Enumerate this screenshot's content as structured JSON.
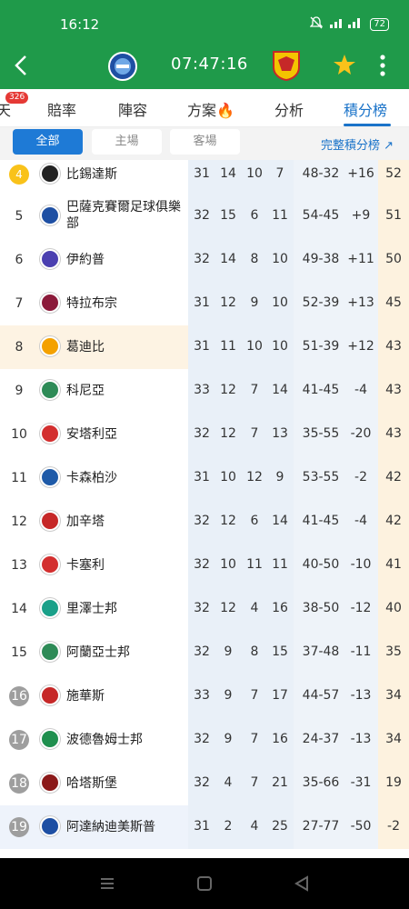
{
  "status": {
    "time": "16:12",
    "battery": "72"
  },
  "header": {
    "clock": "07:47:16"
  },
  "tabs": [
    {
      "label": "天"
    },
    {
      "label": "賠率"
    },
    {
      "label": "陣容"
    },
    {
      "label": "方案"
    },
    {
      "label": "分析"
    },
    {
      "label": "積分榜"
    }
  ],
  "tab_badge": "326",
  "filter": {
    "all": "全部",
    "home": "主場",
    "away": "客場",
    "full_link": "完整積分榜 ↗"
  },
  "colors": {
    "brand_green": "#1f9a4a",
    "accent_blue": "#1a73c9",
    "highlight_row": "#fdf3e3"
  },
  "rows": [
    {
      "rank": "4",
      "team": "比錫達斯",
      "p": "31",
      "w": "14",
      "d": "10",
      "l": "7",
      "gf": "48-32",
      "gd": "+16",
      "pts": "52"
    },
    {
      "rank": "5",
      "team": "巴薩克賽爾足球俱樂部",
      "p": "32",
      "w": "15",
      "d": "6",
      "l": "11",
      "gf": "54-45",
      "gd": "+9",
      "pts": "51"
    },
    {
      "rank": "6",
      "team": "伊約普",
      "p": "32",
      "w": "14",
      "d": "8",
      "l": "10",
      "gf": "49-38",
      "gd": "+11",
      "pts": "50"
    },
    {
      "rank": "7",
      "team": "特拉布宗",
      "p": "31",
      "w": "12",
      "d": "9",
      "l": "10",
      "gf": "52-39",
      "gd": "+13",
      "pts": "45"
    },
    {
      "rank": "8",
      "team": "葛迪比",
      "p": "31",
      "w": "11",
      "d": "10",
      "l": "10",
      "gf": "51-39",
      "gd": "+12",
      "pts": "43"
    },
    {
      "rank": "9",
      "team": "科尼亞",
      "p": "33",
      "w": "12",
      "d": "7",
      "l": "14",
      "gf": "41-45",
      "gd": "-4",
      "pts": "43"
    },
    {
      "rank": "10",
      "team": "安塔利亞",
      "p": "32",
      "w": "12",
      "d": "7",
      "l": "13",
      "gf": "35-55",
      "gd": "-20",
      "pts": "43"
    },
    {
      "rank": "11",
      "team": "卡森柏沙",
      "p": "31",
      "w": "10",
      "d": "12",
      "l": "9",
      "gf": "53-55",
      "gd": "-2",
      "pts": "42"
    },
    {
      "rank": "12",
      "team": "加辛塔",
      "p": "32",
      "w": "12",
      "d": "6",
      "l": "14",
      "gf": "41-45",
      "gd": "-4",
      "pts": "42"
    },
    {
      "rank": "13",
      "team": "卡塞利",
      "p": "32",
      "w": "10",
      "d": "11",
      "l": "11",
      "gf": "40-50",
      "gd": "-10",
      "pts": "41"
    },
    {
      "rank": "14",
      "team": "里澤士邦",
      "p": "32",
      "w": "12",
      "d": "4",
      "l": "16",
      "gf": "38-50",
      "gd": "-12",
      "pts": "40"
    },
    {
      "rank": "15",
      "team": "阿蘭亞士邦",
      "p": "32",
      "w": "9",
      "d": "8",
      "l": "15",
      "gf": "37-48",
      "gd": "-11",
      "pts": "35"
    },
    {
      "rank": "16",
      "team": "施華斯",
      "p": "33",
      "w": "9",
      "d": "7",
      "l": "17",
      "gf": "44-57",
      "gd": "-13",
      "pts": "34"
    },
    {
      "rank": "17",
      "team": "波德魯姆士邦",
      "p": "32",
      "w": "9",
      "d": "7",
      "l": "16",
      "gf": "24-37",
      "gd": "-13",
      "pts": "34"
    },
    {
      "rank": "18",
      "team": "哈塔斯堡",
      "p": "32",
      "w": "4",
      "d": "7",
      "l": "21",
      "gf": "35-66",
      "gd": "-31",
      "pts": "19"
    },
    {
      "rank": "19",
      "team": "阿達納迪美斯普",
      "p": "31",
      "w": "2",
      "d": "4",
      "l": "25",
      "gf": "27-77",
      "gd": "-50",
      "pts": "-2"
    }
  ]
}
